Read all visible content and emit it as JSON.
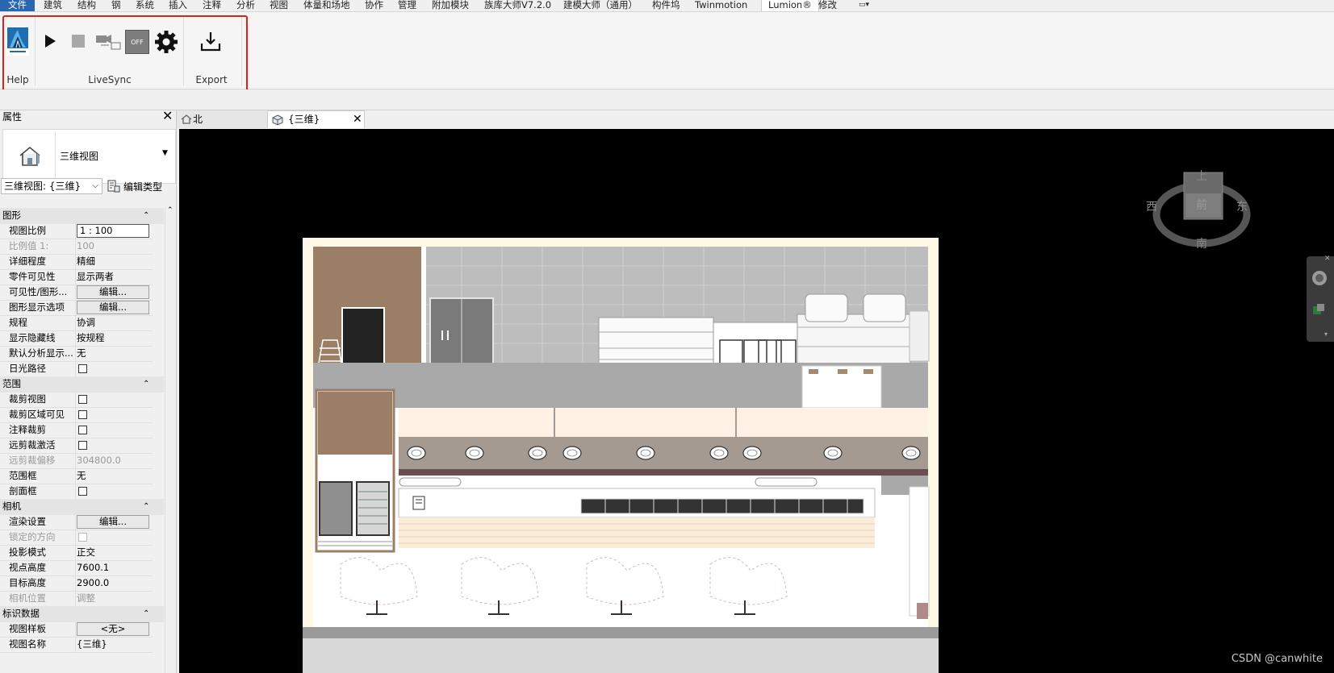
{
  "menu": {
    "items": [
      "文件",
      "建筑",
      "结构",
      "钢",
      "系统",
      "插入",
      "注释",
      "分析",
      "视图",
      "体量和场地",
      "协作",
      "管理",
      "附加模块",
      "族库大师V7.2.0",
      "建模大师（通用）",
      "构件坞",
      "Twinmotion",
      "Lumion®",
      "修改"
    ],
    "active": "Lumion®",
    "extra_icon": "panel-dropdown-icon"
  },
  "ribbon": {
    "groups": {
      "help": "Help",
      "livesync": "LiveSync",
      "export": "Export"
    },
    "buttons": {
      "logo": "lumion-logo-icon",
      "play": "play-icon",
      "stop": "stop-icon",
      "camera_sync": "camera-sync-icon",
      "toggle_text": "OFF",
      "settings": "gear-icon",
      "export": "download-icon"
    },
    "highlight_color": "#e0201a"
  },
  "properties": {
    "title": "属性",
    "type_name": "三维视图",
    "instance_combo": "三维视图: {三维}",
    "edit_type": "编辑类型",
    "rows": [
      {
        "group": "图形"
      },
      {
        "key": "视图比例",
        "value": "1 : 100",
        "kind": "input"
      },
      {
        "key": "比例值 1:",
        "value": "100",
        "kind": "text",
        "disabled": true
      },
      {
        "key": "详细程度",
        "value": "精细",
        "kind": "text"
      },
      {
        "key": "零件可见性",
        "value": "显示两者",
        "kind": "text"
      },
      {
        "key": "可见性/图形...",
        "value": "编辑...",
        "kind": "button"
      },
      {
        "key": "图形显示选项",
        "value": "编辑...",
        "kind": "button"
      },
      {
        "key": "规程",
        "value": "协调",
        "kind": "text"
      },
      {
        "key": "显示隐藏线",
        "value": "按规程",
        "kind": "text"
      },
      {
        "key": "默认分析显示...",
        "value": "无",
        "kind": "text"
      },
      {
        "key": "日光路径",
        "value": "",
        "kind": "check"
      },
      {
        "group": "范围"
      },
      {
        "key": "裁剪视图",
        "value": "",
        "kind": "check"
      },
      {
        "key": "裁剪区域可见",
        "value": "",
        "kind": "check"
      },
      {
        "key": "注释裁剪",
        "value": "",
        "kind": "check"
      },
      {
        "key": "远剪裁激活",
        "value": "",
        "kind": "check"
      },
      {
        "key": "远剪裁偏移",
        "value": "304800.0",
        "kind": "text",
        "disabled": true
      },
      {
        "key": "范围框",
        "value": "无",
        "kind": "text"
      },
      {
        "key": "剖面框",
        "value": "",
        "kind": "check"
      },
      {
        "group": "相机"
      },
      {
        "key": "渲染设置",
        "value": "编辑...",
        "kind": "button"
      },
      {
        "key": "锁定的方向",
        "value": "",
        "kind": "check",
        "disabled": true
      },
      {
        "key": "投影模式",
        "value": "正交",
        "kind": "text"
      },
      {
        "key": "视点高度",
        "value": "7600.1",
        "kind": "text"
      },
      {
        "key": "目标高度",
        "value": "2900.0",
        "kind": "text"
      },
      {
        "key": "相机位置",
        "value": "调整",
        "kind": "text",
        "disabled": true
      },
      {
        "group": "标识数据"
      },
      {
        "key": "视图样板",
        "value": "<无>",
        "kind": "button"
      },
      {
        "key": "视图名称",
        "value": "{三维}",
        "kind": "text"
      }
    ]
  },
  "tabs": [
    {
      "label": "北",
      "icon": "home-icon",
      "active": false
    },
    {
      "label": "{三维}",
      "icon": "cube-icon",
      "active": true,
      "closable": true
    }
  ],
  "viewcube": {
    "top": "上",
    "front": "前",
    "west": "西",
    "east": "东",
    "south": "南"
  },
  "watermark": "CSDN @canwhite"
}
